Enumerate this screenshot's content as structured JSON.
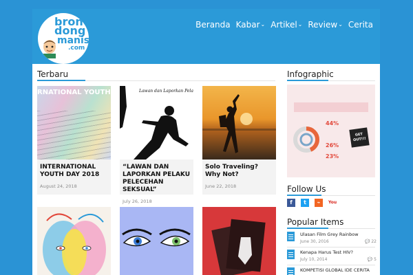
{
  "site": {
    "logo": {
      "line1": "bron",
      "line2": "dong",
      "line3": "manis",
      "line4": ".com"
    }
  },
  "nav": {
    "items": [
      {
        "label": "Beranda",
        "has_caret": false
      },
      {
        "label": "Kabar",
        "has_caret": true
      },
      {
        "label": "Artikel",
        "has_caret": true
      },
      {
        "label": "Review",
        "has_caret": true
      },
      {
        "label": "Cerita",
        "has_caret": false
      }
    ]
  },
  "main": {
    "section_title": "Terbaru",
    "posts": [
      {
        "title": "INTERNATIONAL YOUTH DAY 2018",
        "date": "August 24, 2018",
        "image_text": "RNATIONAL YOUTH"
      },
      {
        "title": "“LAWAN DAN LAPORKAN PELAKU PELECEHAN SEKSUAL”",
        "date": "July 26, 2018",
        "image_text": "Lawan dan Laporkan Pelaku Pe"
      },
      {
        "title": "Solo Traveling? Why Not?",
        "date": "June 22, 2018",
        "image_text": ""
      }
    ]
  },
  "sidebar": {
    "infographic_title": "Infographic",
    "infographic": {
      "stats": [
        "44%",
        "26%",
        "23%"
      ],
      "badge": "GET OUT!!!"
    },
    "follow_title": "Follow Us",
    "social_icons": [
      "facebook-icon",
      "twitter-icon",
      "rss-icon",
      "youtube-icon"
    ],
    "popular_title": "Popular Items",
    "popular": [
      {
        "title": "Ulasan Film Grey Rainbow",
        "date": "June 30, 2016",
        "comments": "22"
      },
      {
        "title": "Kenapa Harus Test HIV?",
        "date": "July 10, 2014",
        "comments": "5"
      },
      {
        "title": "KOMPETISI GLOBAL IDE CERITA",
        "date": "",
        "comments": ""
      }
    ]
  },
  "colors": {
    "accent": "#2b9ad8",
    "background": "#2a93d5"
  }
}
